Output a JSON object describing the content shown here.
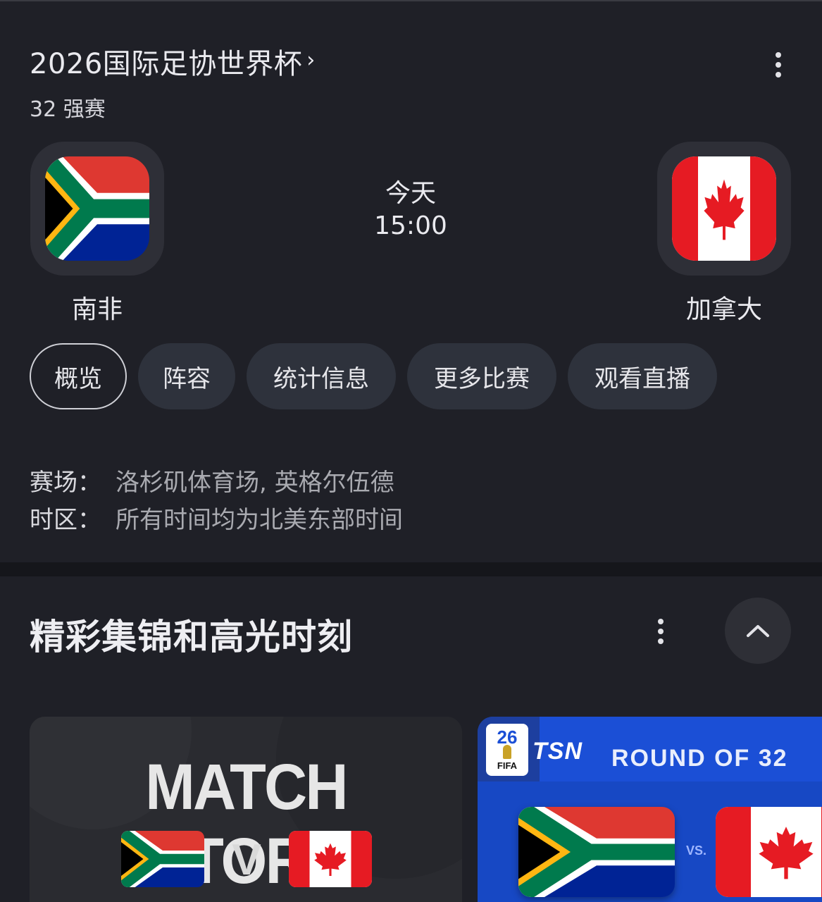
{
  "header": {
    "competition": "2026国际足协世界杯",
    "chevron": "›",
    "stage": "32 强赛"
  },
  "match": {
    "home_team": "南非",
    "away_team": "加拿大",
    "day": "今天",
    "time": "15:00"
  },
  "tabs": [
    {
      "label": "概览",
      "active": true
    },
    {
      "label": "阵容"
    },
    {
      "label": "统计信息"
    },
    {
      "label": "更多比赛"
    },
    {
      "label": "观看直播"
    }
  ],
  "info": {
    "venue_label": "赛场：",
    "venue_value": "洛杉矶体育场, 英格尔伍德",
    "tz_label": "时区：",
    "tz_value": "所有时间均为北美东部时间"
  },
  "highlights": {
    "title": "精彩集锦和高光时刻",
    "card1": {
      "headline": "MATCH STORY",
      "versus": "V"
    },
    "card2": {
      "broadcaster": "TSN",
      "badge_line1": "26",
      "badge_line2": "FIFA",
      "headline": "ROUND OF 32",
      "versus": "VS."
    }
  },
  "icons": {
    "more": "more-vert-icon",
    "collapse": "chevron-up-icon"
  },
  "colors": {
    "background": "#1f2027",
    "chip": "#2e323c",
    "tsn_blue": "#1b4fd6"
  }
}
